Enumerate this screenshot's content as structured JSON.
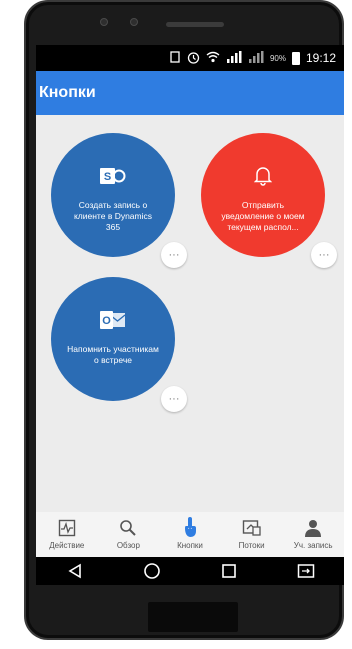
{
  "status_bar": {
    "battery_percent": "90%",
    "time": "19:12",
    "network_label": "N"
  },
  "header": {
    "title": "Кнопки"
  },
  "flows": [
    {
      "icon": "sharepoint-icon",
      "label": "Создать запись о клиенте в Dynamics 365",
      "color": "#2b6cb4"
    },
    {
      "icon": "bell-icon",
      "label": "Отправить уведомление о моем текущем распол...",
      "color": "#f03a2e"
    },
    {
      "icon": "outlook-icon",
      "label": "Напомнить участникам о встрече",
      "color": "#2b6cb4"
    }
  ],
  "more_label": "···",
  "bottom_nav": [
    {
      "icon": "activity-icon",
      "label": "Действие"
    },
    {
      "icon": "search-icon",
      "label": "Обзор"
    },
    {
      "icon": "tap-icon",
      "label": "Кнопки",
      "active": true
    },
    {
      "icon": "flows-icon",
      "label": "Потоки"
    },
    {
      "icon": "person-icon",
      "label": "Уч. запись"
    }
  ],
  "colors": {
    "accent": "#2f7de1",
    "flow_blue": "#2b6cb4",
    "flow_red": "#f03a2e",
    "background": "#ececec"
  }
}
